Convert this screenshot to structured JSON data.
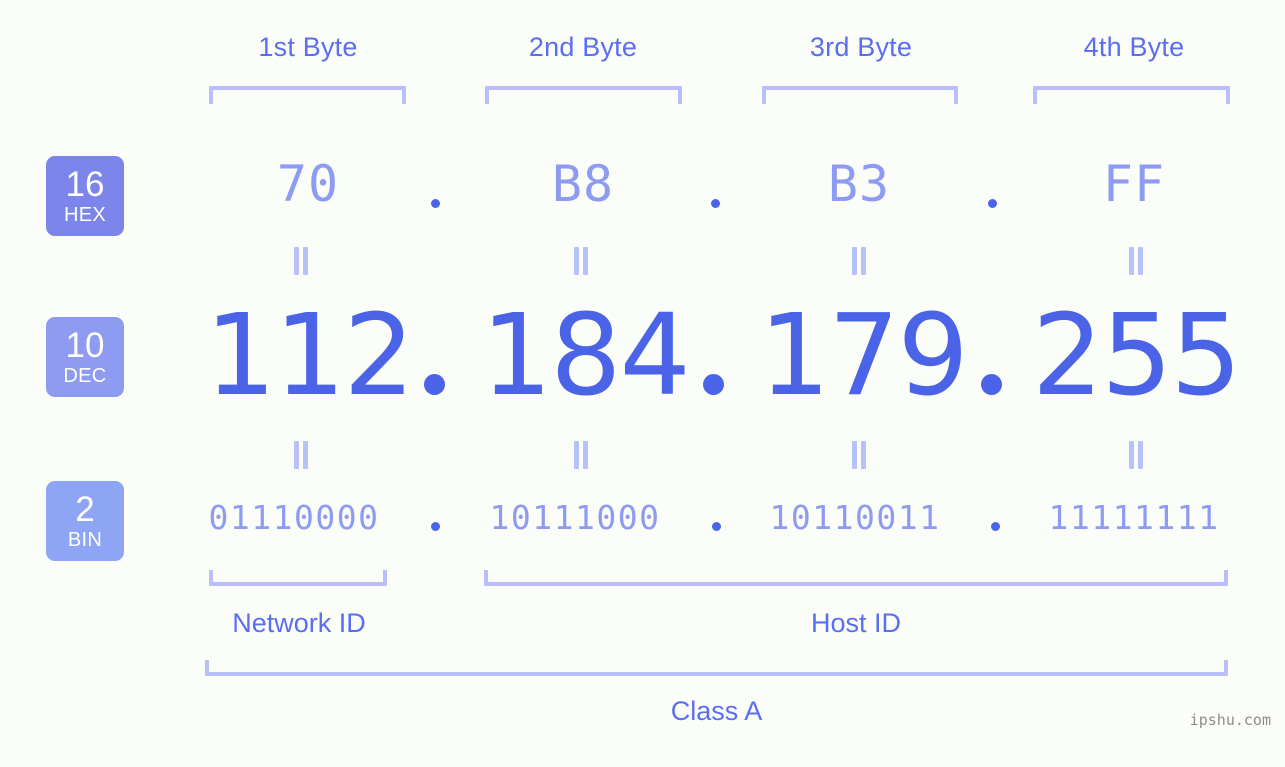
{
  "meta": {
    "background_color": "#fbfdf8",
    "accent_color": "#4a63e7",
    "light_accent_color": "#8e9bf3",
    "bracket_color": "#b7befb"
  },
  "byte_headers": [
    {
      "label": "1st Byte"
    },
    {
      "label": "2nd Byte"
    },
    {
      "label": "3rd Byte"
    },
    {
      "label": "4th Byte"
    }
  ],
  "rows": {
    "hex": {
      "badge_number": "16",
      "badge_label": "HEX",
      "badge_color": "#7b85ea",
      "values": [
        "70",
        "B8",
        "B3",
        "FF"
      ],
      "separator": "."
    },
    "dec": {
      "badge_number": "10",
      "badge_label": "DEC",
      "badge_color": "#8d9bf0",
      "values": [
        "112",
        "184",
        "179",
        "255"
      ],
      "separator": "."
    },
    "bin": {
      "badge_number": "2",
      "badge_label": "BIN",
      "badge_color": "#8ea4f5",
      "values": [
        "01110000",
        "10111000",
        "10110011",
        "11111111"
      ],
      "separator": "."
    }
  },
  "equality_marks": {
    "symbol": "=",
    "count_per_row": 4
  },
  "sections": {
    "network_id": "Network ID",
    "host_id": "Host ID",
    "class": "Class A"
  },
  "watermark": "ipshu.com"
}
